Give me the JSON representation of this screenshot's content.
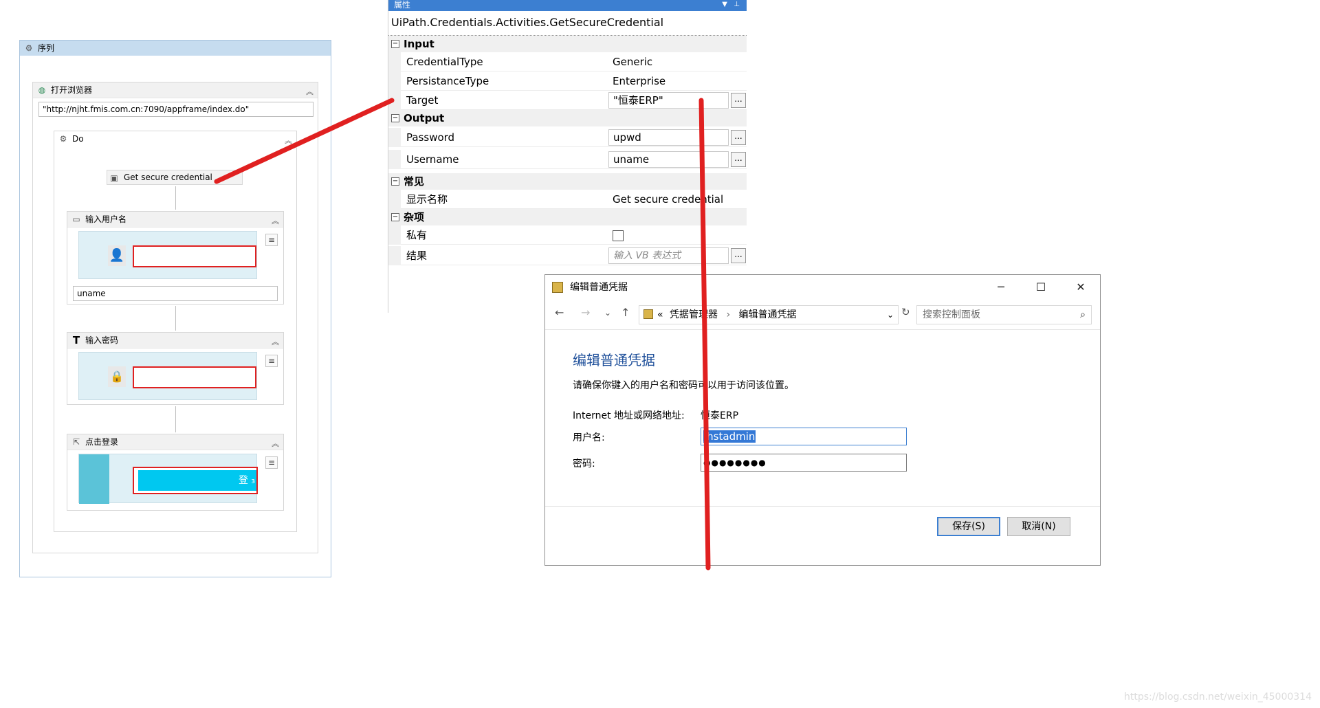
{
  "sequence": {
    "title": "序列",
    "open_browser": {
      "title": "打开浏览器",
      "url": "\"http://njht.fmis.com.cn:7090/appframe/index.do\"",
      "do_label": "Do"
    },
    "get_credential": {
      "label": "Get secure credential"
    },
    "type_username": {
      "title": "输入用户名",
      "value": "uname"
    },
    "type_password": {
      "title": "输入密码"
    },
    "click_login": {
      "title": "点击登录",
      "button_text": "登 ₃"
    }
  },
  "properties": {
    "title": "属性",
    "type_name": "UiPath.Credentials.Activities.GetSecureCredential",
    "categories": [
      {
        "label": "Input",
        "rows": [
          {
            "name": "CredentialType",
            "value": "Generic"
          },
          {
            "name": "PersistanceType",
            "value": "Enterprise"
          },
          {
            "name": "Target",
            "value": "\"恒泰ERP\""
          }
        ]
      },
      {
        "label": "Output",
        "rows": [
          {
            "name": "Password",
            "value": "upwd"
          },
          {
            "name": "Username",
            "value": "uname"
          }
        ]
      },
      {
        "label": "常见",
        "rows": [
          {
            "name": "显示名称",
            "value": "Get secure credential"
          }
        ]
      },
      {
        "label": "杂项",
        "rows": [
          {
            "name": "私有",
            "value": ""
          },
          {
            "name": "结果",
            "placeholder": "输入 VB 表达式"
          }
        ]
      }
    ],
    "ellipsis": "..."
  },
  "dialog": {
    "title": "编辑普通凭据",
    "breadcrumb_sep": "«",
    "breadcrumb": [
      "凭据管理器",
      "编辑普通凭据"
    ],
    "search_placeholder": "搜索控制面板",
    "heading": "编辑普通凭据",
    "description": "请确保你键入的用户名和密码可以用于访问该位置。",
    "address_label": "Internet 地址或网络地址:",
    "address_value": "恒泰ERP",
    "username_label": "用户名:",
    "username_value": "jhstadmin",
    "password_label": "密码:",
    "password_mask": "●●●●●●●●",
    "save": "保存(S)",
    "cancel": "取消(N)"
  },
  "watermark": "https://blog.csdn.net/weixin_45000314",
  "colors": {
    "annotation": "#e02020",
    "accent": "#3c7fd1",
    "heading": "#1e4f9a"
  }
}
